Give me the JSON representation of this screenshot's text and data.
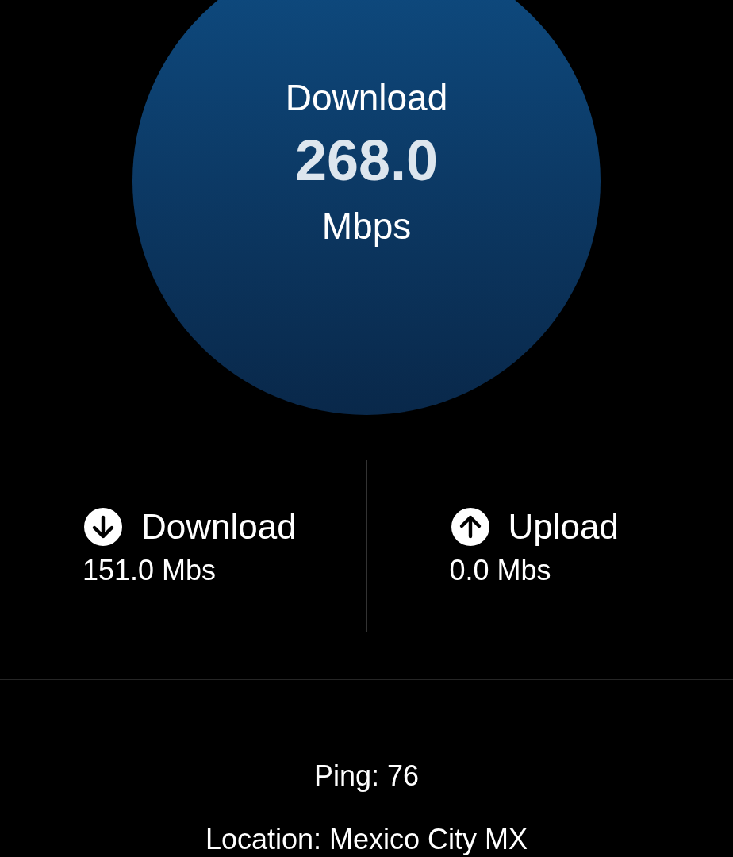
{
  "gauge": {
    "label": "Download",
    "value": "268.0",
    "unit": "Mbps"
  },
  "stats": [
    {
      "kind": "download",
      "label": "Download",
      "value": "151.0 Mbs"
    },
    {
      "kind": "upload",
      "label": "Upload",
      "value": "0.0 Mbs"
    }
  ],
  "ping": "Ping: 76",
  "location": "Location: Mexico City MX"
}
